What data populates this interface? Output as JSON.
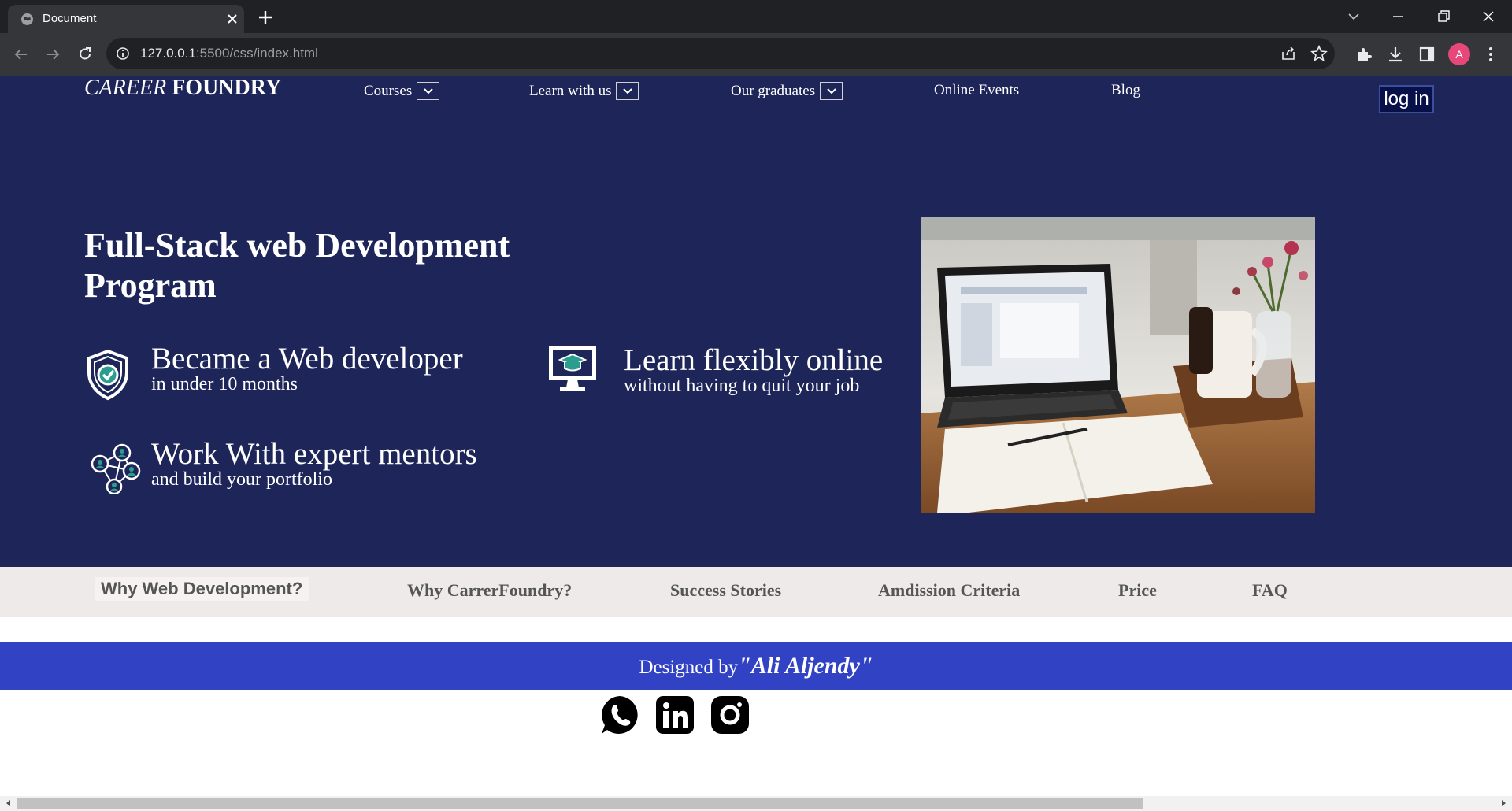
{
  "browser": {
    "tab_title": "Document",
    "url_host": "127.0.0.1",
    "url_path": ":5500/css/index.html",
    "profile_initial": "A"
  },
  "site": {
    "logo_italic": "CAREER",
    "logo_bold": "FOUNDRY",
    "nav": [
      {
        "label": "Courses",
        "has_dropdown": true
      },
      {
        "label": "Learn with us",
        "has_dropdown": true
      },
      {
        "label": "Our graduates",
        "has_dropdown": true
      },
      {
        "label": "Online Events",
        "has_dropdown": false
      },
      {
        "label": "Blog",
        "has_dropdown": false
      }
    ],
    "login_label": "log in"
  },
  "hero": {
    "title": "Full-Stack web Development Program",
    "features": [
      {
        "icon": "shield-check-icon",
        "heading": "Became a Web developer",
        "sub": "in under 10 months"
      },
      {
        "icon": "monitor-graduation-cap-icon",
        "heading": "Learn flexibly online",
        "sub": "without having to quit your job"
      },
      {
        "icon": "network-people-icon",
        "heading": "Work With expert mentors",
        "sub": "and build your portfolio"
      }
    ],
    "image_description_icon": "laptop-desk-photo"
  },
  "subnav": [
    "Why Web Development?",
    "Why CarrerFoundry?",
    "Success Stories",
    "Amdission Criteria",
    "Price",
    "FAQ"
  ],
  "footer": {
    "designed_by": "Designed by",
    "author": "\"Ali Aljendy\"",
    "socials": [
      "whatsapp-icon",
      "linkedin-icon",
      "instagram-icon"
    ]
  },
  "colors": {
    "hero_bg": "#1e2659",
    "subnav_bg": "#efeaea",
    "footer_bg": "#3142c4"
  }
}
